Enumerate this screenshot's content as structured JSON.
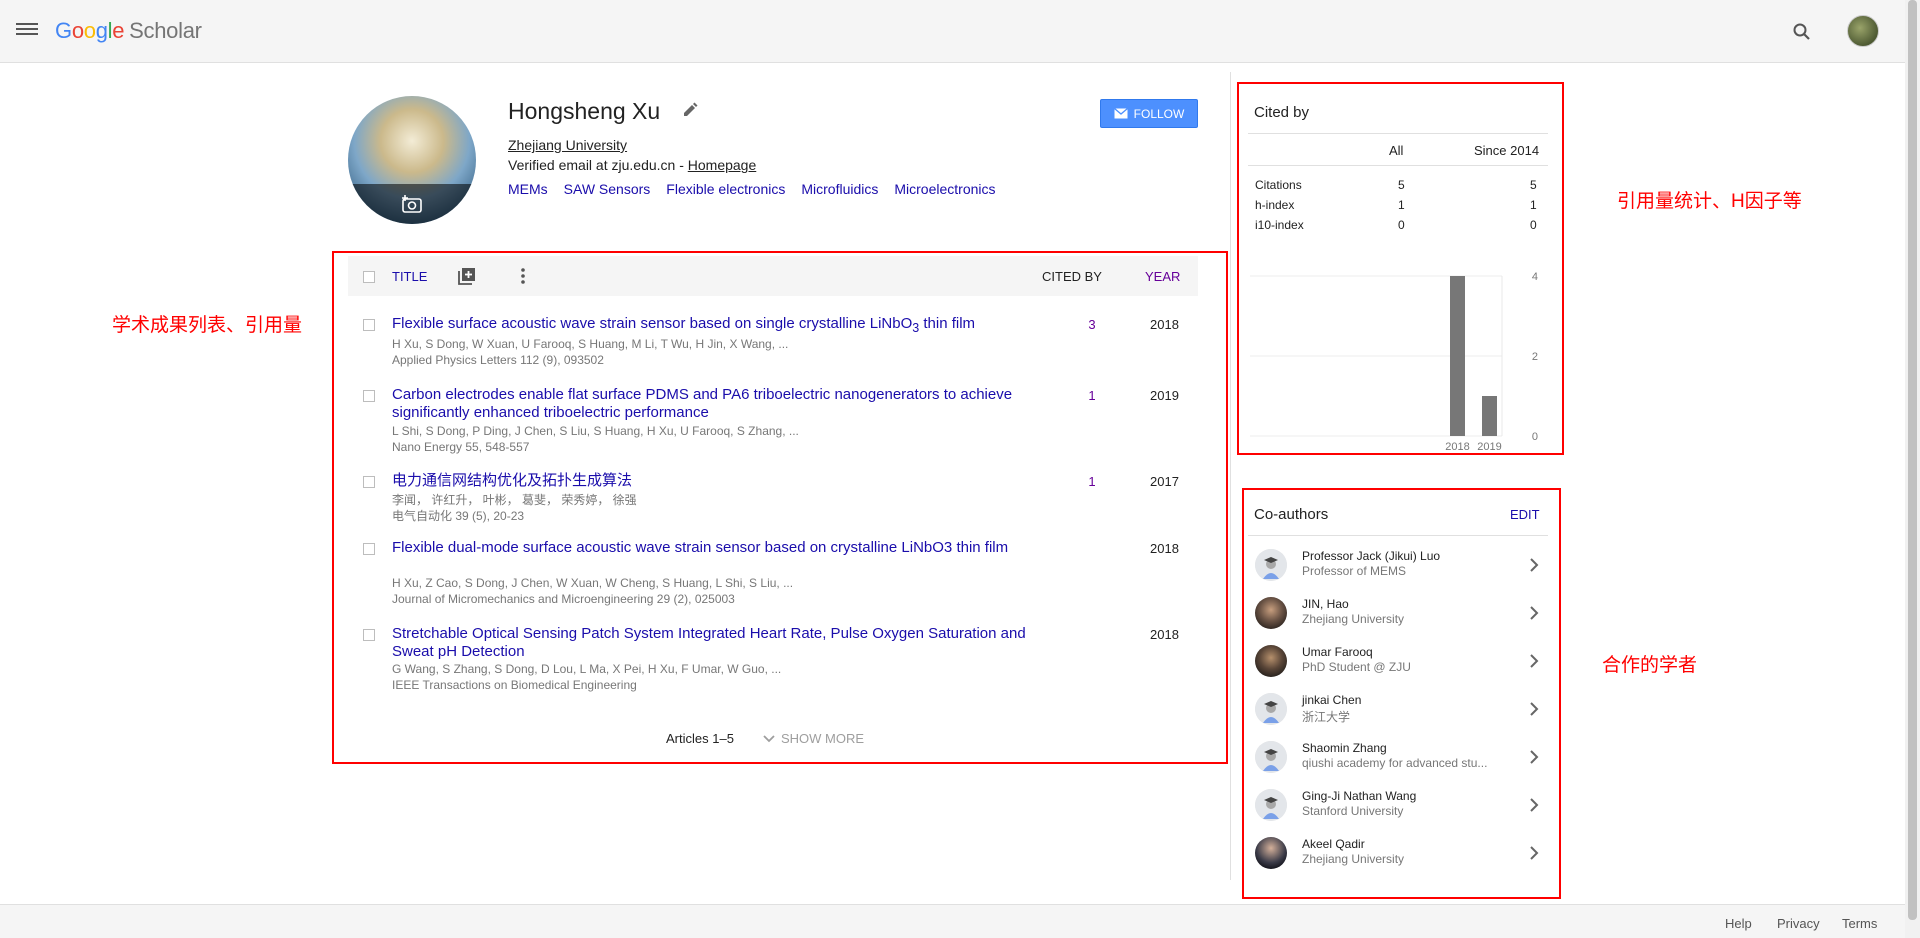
{
  "header": {
    "logo_letters": [
      "G",
      "o",
      "o",
      "g",
      "l",
      "e"
    ],
    "logo_product": "Scholar",
    "icons": [
      "menu-icon",
      "search-icon",
      "avatar"
    ]
  },
  "profile": {
    "name": "Hongsheng Xu",
    "affiliation": "Zhejiang University",
    "verified_prefix": "Verified email at zju.edu.cn - ",
    "homepage": "Homepage",
    "interests": [
      "MEMs",
      "SAW Sensors",
      "Flexible electronics",
      "Microfluidics",
      "Microelectronics"
    ],
    "follow_label": "FOLLOW"
  },
  "table": {
    "col_title": "TITLE",
    "col_cited": "CITED BY",
    "col_year": "YEAR",
    "articles": [
      {
        "title_main": "Flexible surface acoustic wave strain sensor based on single crystalline LiNbO",
        "title_sub": "3",
        "title_tail": " thin film",
        "authors": "H Xu, S Dong, W Xuan, U Farooq, S Huang, M Li, T Wu, H Jin, X Wang, ...",
        "venue": "Applied Physics Letters 112 (9), 093502",
        "cited": "3",
        "year": "2018"
      },
      {
        "title": "Carbon electrodes enable flat surface PDMS and PA6 triboelectric nanogenerators to achieve significantly enhanced triboelectric performance",
        "authors": "L Shi, S Dong, P Ding, J Chen, S Liu, S Huang, H Xu, U Farooq, S Zhang, ...",
        "venue": "Nano Energy 55, 548-557",
        "cited": "1",
        "year": "2019"
      },
      {
        "title": "电力通信网结构优化及拓扑生成算法",
        "authors": "李闻， 许红升， 叶彬， 葛斐， 荣秀婷， 徐强",
        "venue": "电气自动化 39 (5), 20-23",
        "cited": "1",
        "year": "2017"
      },
      {
        "title": "Flexible dual-mode surface acoustic wave strain sensor based on crystalline LiNbO3 thin film",
        "authors": "H Xu, Z Cao, S Dong, J Chen, W Xuan, W Cheng, S Huang, L Shi, S Liu, ...",
        "venue": "Journal of Micromechanics and Microengineering 29 (2), 025003",
        "cited": "",
        "year": "2018"
      },
      {
        "title": "Stretchable Optical Sensing Patch System Integrated Heart Rate, Pulse Oxygen Saturation and Sweat pH Detection",
        "authors": "G Wang, S Zhang, S Dong, D Lou, L Ma, X Pei, H Xu, F Umar, W Guo, ...",
        "venue": "IEEE Transactions on Biomedical Engineering",
        "cited": "",
        "year": "2018"
      }
    ],
    "articles_count": "Articles 1–5",
    "show_more": "SHOW MORE"
  },
  "cited_by": {
    "title": "Cited by",
    "col_all": "All",
    "col_since": "Since 2014",
    "rows": [
      {
        "label": "Citations",
        "all": "5",
        "since": "5"
      },
      {
        "label": "h-index",
        "all": "1",
        "since": "1"
      },
      {
        "label": "i10-index",
        "all": "0",
        "since": "0"
      }
    ]
  },
  "chart_data": {
    "type": "bar",
    "categories": [
      "2018",
      "2019"
    ],
    "values": [
      4,
      1
    ],
    "ylim": [
      0,
      4
    ],
    "yticks": [
      0,
      2,
      4
    ],
    "grid": true,
    "bar_color": "#777777"
  },
  "coauthors": {
    "title": "Co-authors",
    "edit_label": "EDIT",
    "items": [
      {
        "name": "Professor Jack (Jikui) Luo",
        "affiliation": "Professor of MEMS",
        "avatar": "default"
      },
      {
        "name": "JIN, Hao",
        "affiliation": "Zhejiang University",
        "avatar": "photo1"
      },
      {
        "name": "Umar Farooq",
        "affiliation": "PhD Student @ ZJU",
        "avatar": "photo2"
      },
      {
        "name": "jinkai Chen",
        "affiliation": "浙江大学",
        "avatar": "default"
      },
      {
        "name": "Shaomin Zhang",
        "affiliation": "qiushi academy for advanced stu...",
        "avatar": "default"
      },
      {
        "name": "Ging-Ji Nathan Wang",
        "affiliation": "Stanford University",
        "avatar": "default"
      },
      {
        "name": "Akeel Qadir",
        "affiliation": "Zhejiang University",
        "avatar": "photo3"
      }
    ]
  },
  "annotations": {
    "articles_note": "学术成果列表、引用量",
    "citations_note": "引用量统计、H因子等",
    "coauthors_note": "合作的学者",
    "color": "#ff0000"
  },
  "footer": {
    "help": "Help",
    "privacy": "Privacy",
    "terms": "Terms"
  }
}
